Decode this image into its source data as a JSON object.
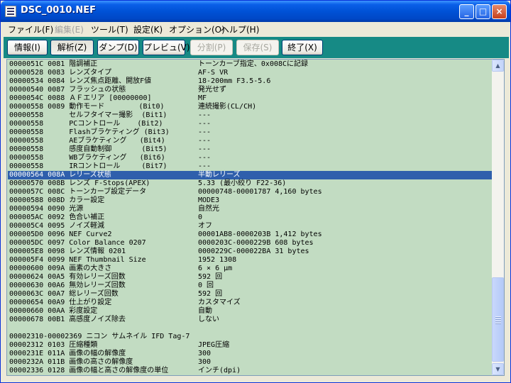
{
  "window": {
    "title": "DSC_0010.NEF",
    "icon": "app-icon",
    "controls": {
      "minimize": "_",
      "maximize": "□",
      "close": "×"
    }
  },
  "menu": [
    {
      "label": "ファイル(F)",
      "enabled": true
    },
    {
      "label": "編集(E)",
      "enabled": false
    },
    {
      "label": "ツール(T)",
      "enabled": true
    },
    {
      "label": "設定(K)",
      "enabled": true
    },
    {
      "label": "オプション(O)",
      "enabled": true
    },
    {
      "label": "ヘルプ(H)",
      "enabled": true
    }
  ],
  "toolbar": [
    {
      "label": "情報(I)",
      "enabled": true
    },
    {
      "label": "解析(Z)",
      "enabled": true,
      "pressed": true
    },
    {
      "label": "ダンプ(D)",
      "enabled": true
    },
    {
      "label": "プレビュ(V)",
      "enabled": true
    },
    {
      "label": "分割(P)",
      "enabled": false
    },
    {
      "label": "保存(S)",
      "enabled": false
    },
    {
      "label": "終了(X)",
      "enabled": true
    }
  ],
  "colors": {
    "toolbar_bg": "#168a85",
    "list_bg": "#c2dcc2",
    "selection": "#2f5fac"
  },
  "rows": [
    {
      "left": "0000051C 0081 階調補正",
      "right": "トーンカーブ指定、0x008Cに記録"
    },
    {
      "left": "00000528 0083 レンズタイプ",
      "right": "AF-S VR"
    },
    {
      "left": "00000534 0084 レンズ焦点距離、開放F値",
      "right": "18-200mm F3.5-5.6"
    },
    {
      "left": "00000540 0087 フラッシュの状態",
      "right": "発光せず"
    },
    {
      "left": "0000054C 0088 ＡＦエリア [00000000]",
      "right": "MF"
    },
    {
      "left": "00000558 0089 動作モード        (Bit0)",
      "right": "連続撮影(CL/CH)"
    },
    {
      "left": "00000558      セルフタイマー撮影  (Bit1)",
      "right": "---"
    },
    {
      "left": "00000558      PCコントロール    (Bit2)",
      "right": "---"
    },
    {
      "left": "00000558      Flashブラケティング (Bit3)",
      "right": "---"
    },
    {
      "left": "00000558      AEブラケティング   (Bit4)",
      "right": "---"
    },
    {
      "left": "00000558      感度自動制御       (Bit5)",
      "right": "---"
    },
    {
      "left": "00000558      WBブラケティング   (Bit6)",
      "right": "---"
    },
    {
      "left": "00000558      IRコントロール     (Bit7)",
      "right": "---"
    },
    {
      "left": "00000564 008A レリーズ状態",
      "right": "半動レリーズ",
      "selected": true
    },
    {
      "left": "00000570 008B レンズ F-Stops(APEX)",
      "right": "5.33 (最小絞り F22-36)"
    },
    {
      "left": "0000057C 008C トーンカーブ設定データ",
      "right": "00000748-00001787 4,160 bytes"
    },
    {
      "left": "00000588 008D カラー設定",
      "right": "MODE3"
    },
    {
      "left": "00000594 0090 光源",
      "right": "自然光"
    },
    {
      "left": "000005AC 0092 色合い補正",
      "right": "0"
    },
    {
      "left": "000005C4 0095 ノイズ軽減",
      "right": "オフ"
    },
    {
      "left": "000005D0 0096 NEF Curve2",
      "right": "00001AB8-0000203B 1,412 bytes"
    },
    {
      "left": "000005DC 0097 Color Balance 0207",
      "right": "0000203C-0000229B 608 bytes"
    },
    {
      "left": "000005E8 0098 レンズ情報 0201",
      "right": "0000229C-000022BA 31 bytes"
    },
    {
      "left": "000005F4 0099 NEF Thumbnail Size",
      "right": "1952 1308"
    },
    {
      "left": "00000600 009A 画素の大きさ",
      "right": "6 × 6 μm"
    },
    {
      "left": "00000624 00A5 有効レリーズ回数",
      "right": "592 回"
    },
    {
      "left": "00000630 00A6 無効レリーズ回数",
      "right": "0 回"
    },
    {
      "left": "0000063C 00A7 総レリーズ回数",
      "right": "592 回"
    },
    {
      "left": "00000654 00A9 仕上がり設定",
      "right": "カスタマイズ"
    },
    {
      "left": "00000660 00AA 彩度設定",
      "right": "自動"
    },
    {
      "left": "00000678 00B1 高感度ノイズ除去",
      "right": "しない"
    },
    {
      "left": "",
      "right": "",
      "blank": true
    },
    {
      "left": "00002310-00002369 ニコン サムネイル IFD Tag-7",
      "right": ""
    },
    {
      "left": "00002312 0103 圧縮種類",
      "right": "JPEG圧縮"
    },
    {
      "left": "0000231E 011A 画像の幅の解像度",
      "right": "300"
    },
    {
      "left": "0000232A 011B 画像の高さの解像度",
      "right": "300"
    },
    {
      "left": "00002336 0128 画像の幅と高さの解像度の単位",
      "right": "インチ(dpi)"
    }
  ],
  "scrollbar": {
    "up": "▲",
    "down": "▼",
    "position": 0.78
  }
}
